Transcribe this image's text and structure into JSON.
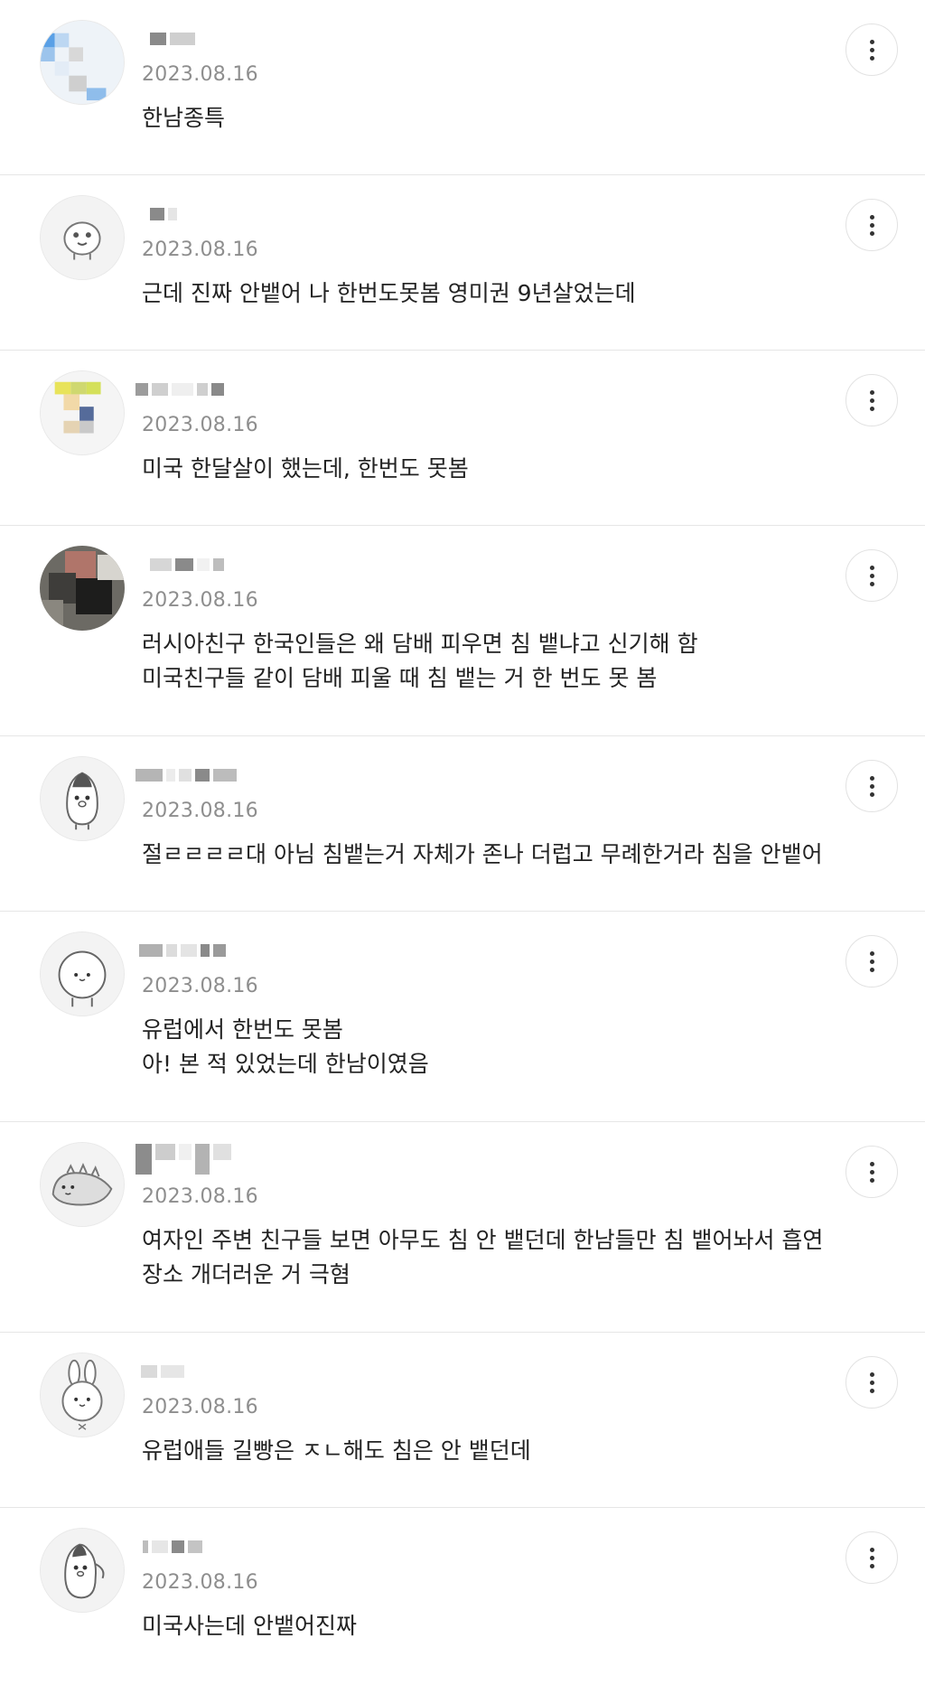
{
  "comments": [
    {
      "date": "2023.08.16",
      "lines": [
        "한남종특"
      ],
      "avatar": "pixelated-photo"
    },
    {
      "date": "2023.08.16",
      "lines": [
        "근데 진짜 안뱉어 나 한번도못봄 영미권 9년살었는데"
      ],
      "avatar": "cartoon-bear"
    },
    {
      "date": "2023.08.16",
      "lines": [
        "미국 한달살이 했는데, 한번도 못봄"
      ],
      "avatar": "pixelated-photo"
    },
    {
      "date": "2023.08.16",
      "lines": [
        "러시아친구 한국인들은 왜 담배 피우면 침 뱉냐고 신기해 함",
        "미국친구들 같이 담배 피울 때 침 뱉는 거 한 번도 못 봄"
      ],
      "avatar": "photo"
    },
    {
      "date": "2023.08.16",
      "lines": [
        "절ㄹㄹㄹㄹ대 아님 침뱉는거 자체가 존나 더럽고 무례한거라 침을 안뱉어"
      ],
      "avatar": "cartoon-penguin"
    },
    {
      "date": "2023.08.16",
      "lines": [
        "유럽에서 한번도 못봄",
        "아! 본 적 있었는데 한남이였음"
      ],
      "avatar": "cartoon-blob"
    },
    {
      "date": "2023.08.16",
      "lines": [
        "여자인 주변 친구들 보면 아무도 침 안 뱉던데 한남들만 침 뱉어놔서 흡연",
        "장소 개더러운 거 극혐"
      ],
      "avatar": "cartoon-dino"
    },
    {
      "date": "2023.08.16",
      "lines": [
        "유럽애들 길빵은 ㅈㄴ해도 침은 안 뱉던데"
      ],
      "avatar": "cartoon-rabbit"
    },
    {
      "date": "2023.08.16",
      "lines": [
        "미국사는데 안뱉어진짜"
      ],
      "avatar": "cartoon-penguin"
    }
  ],
  "icons": {
    "more": "more-vertical-icon"
  }
}
